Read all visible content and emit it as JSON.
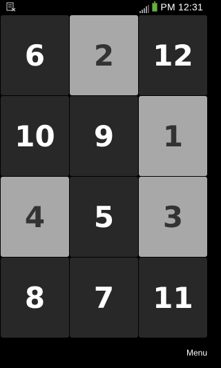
{
  "status_bar": {
    "time": "PM 12:31",
    "notification_icon": "usb-debug-icon",
    "signal_icon": "signal-bars-icon",
    "battery_icon": "battery-icon",
    "battery_level": 1.0,
    "battery_color": "#5cb82a"
  },
  "board": {
    "rows": 4,
    "columns": 3,
    "tiles": [
      {
        "label": "6",
        "style": "dark"
      },
      {
        "label": "2",
        "style": "light"
      },
      {
        "label": "12",
        "style": "dark"
      },
      {
        "label": "10",
        "style": "dark"
      },
      {
        "label": "9",
        "style": "dark"
      },
      {
        "label": "1",
        "style": "light"
      },
      {
        "label": "4",
        "style": "light"
      },
      {
        "label": "5",
        "style": "dark"
      },
      {
        "label": "3",
        "style": "light"
      },
      {
        "label": "8",
        "style": "dark"
      },
      {
        "label": "7",
        "style": "dark"
      },
      {
        "label": "11",
        "style": "dark"
      }
    ],
    "colors": {
      "dark_tile": "#282828",
      "light_tile": "#a8a8a8",
      "dark_text": "#ffffff",
      "light_text": "#333333"
    }
  },
  "bottom_bar": {
    "menu_label": "Menu"
  }
}
